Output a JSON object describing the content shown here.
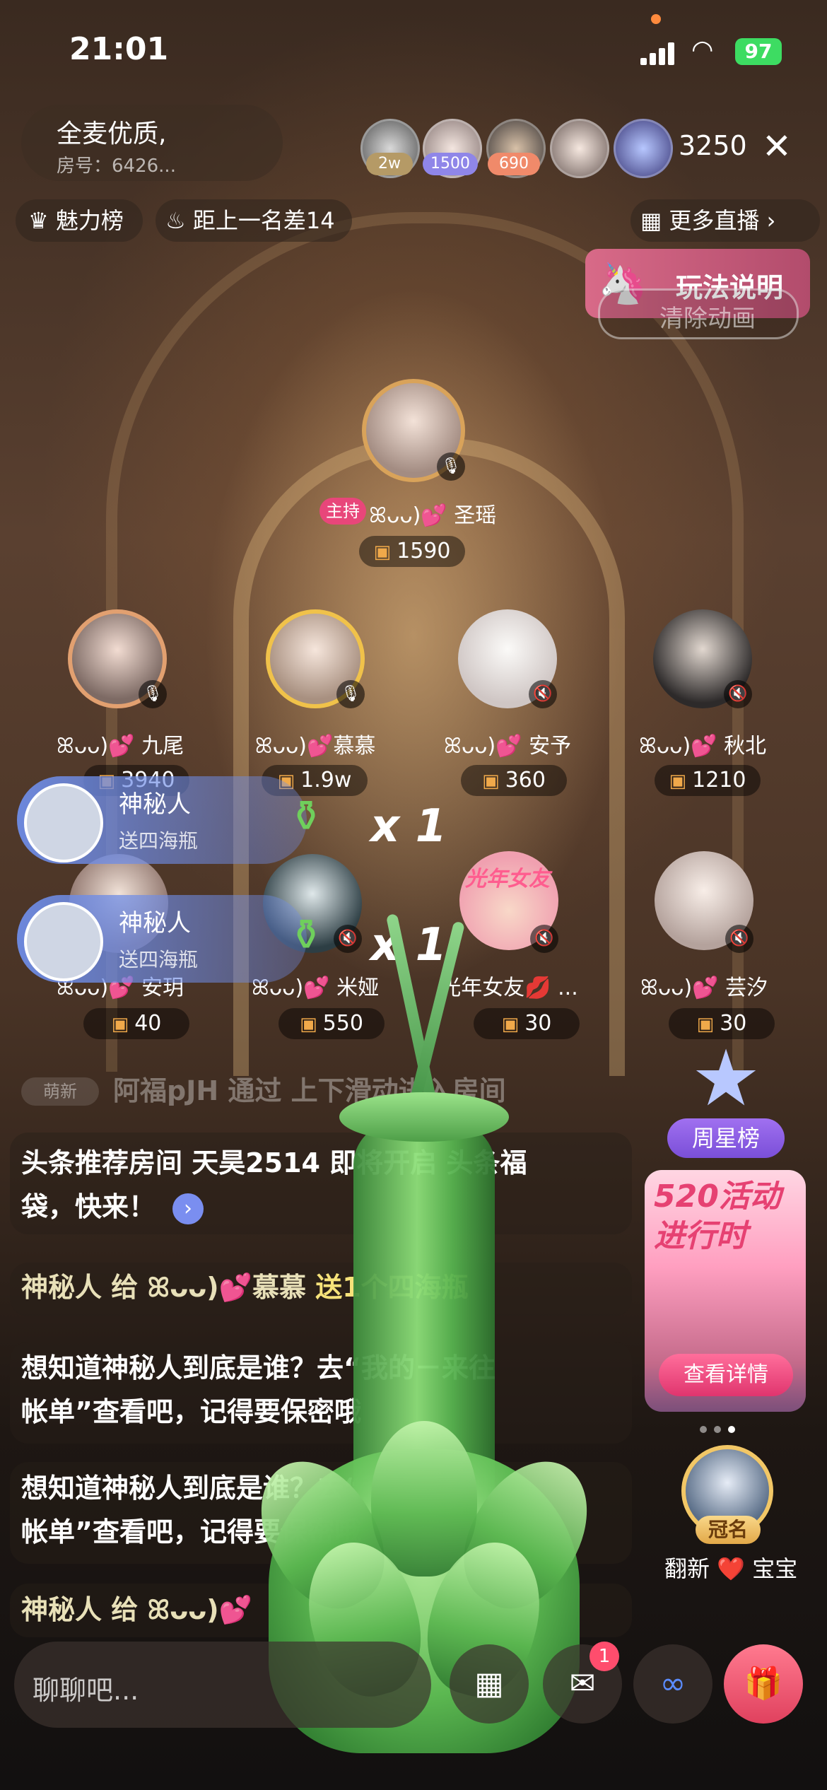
{
  "status_bar": {
    "time": "21:01",
    "battery": "97"
  },
  "room": {
    "name": "全麦优质,",
    "id": "房号：6426...",
    "viewer_count": "3250",
    "top_viewers": [
      {
        "badge": "2w",
        "badge_color": "#b59a66"
      },
      {
        "badge": "1500",
        "badge_color": "#8f86e8"
      },
      {
        "badge": "690",
        "badge_color": "#f08a6a"
      },
      {
        "badge": "",
        "badge_color": ""
      },
      {
        "badge": "",
        "badge_color": ""
      }
    ]
  },
  "toolbar": {
    "charm_rank": "魅力榜",
    "gap_text": "距上一名差14",
    "more_live": "更多直播",
    "rules": "玩法说明",
    "clear_anim": "清除动画"
  },
  "host": {
    "tag": "主持",
    "name": "ꕤᴗᴗ)💕 圣瑶",
    "score": "1590"
  },
  "seats": [
    {
      "name": "ꕤᴗᴗ)💕 九尾",
      "score": "3940"
    },
    {
      "name": "ꕤᴗᴗ)💕慕慕",
      "score": "1.9w"
    },
    {
      "name": "ꕤᴗᴗ)💕 安予",
      "score": "360"
    },
    {
      "name": "ꕤᴗᴗ)💕 秋北",
      "score": "1210"
    },
    {
      "name": "ꕤᴗᴗ)💕 安玥",
      "score": "40"
    },
    {
      "name": "ꕤᴗᴗ)💕 米娅",
      "score": "550"
    },
    {
      "name": "光年女友💋 ...",
      "score": "30",
      "poster": "光年女友"
    },
    {
      "name": "ꕤᴗᴗ)💕 芸汐",
      "score": "30"
    }
  ],
  "gift_banners": [
    {
      "user": "神秘人",
      "action": "送四海瓶",
      "count": "x 1"
    },
    {
      "user": "神秘人",
      "action": "送四海瓶",
      "count": "x 1"
    }
  ],
  "chat": {
    "system_tag": "萌新",
    "join": "阿福pJH 通过 上下滑动进入房间",
    "msg1": "头条推荐房间 天昊2514 即将开启 头条福",
    "msg1b": "袋，快来！",
    "msg2a": "神秘人 给 ꕤᴗᴗ)💕",
    "msg2b": "慕慕",
    "msg2c": "送1个四海瓶",
    "msg3": "想知道神秘人到底是谁？去“我的－来往",
    "msg3b": "帐单”查看吧，记得要保密哦",
    "msg4": "想知道神秘人到底是谁？去“我的－来往",
    "msg4b": "帐单”查看吧，记得要保密哦",
    "msg5": "神秘人 给 ꕤᴗᴗ)💕"
  },
  "right_panel": {
    "star_rank": "周星榜",
    "promo_title": "520活动进行时",
    "promo_button": "查看详情",
    "crown_tag": "冠名",
    "crown_name": "翻新 ❤️ 宝宝"
  },
  "bottom": {
    "input_placeholder": "聊聊吧...",
    "message_badge": "1"
  }
}
